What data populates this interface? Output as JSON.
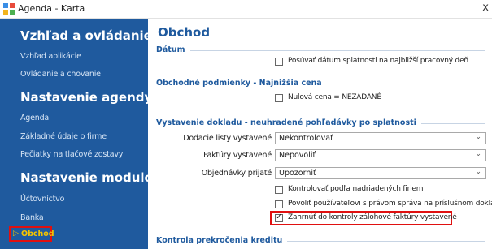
{
  "window": {
    "title": "Agenda - Karta",
    "close_glyph": "x"
  },
  "sidebar": {
    "sections": [
      {
        "heading": "Vzhľad a ovládanie",
        "items": [
          "Vzhľad aplikácie",
          "Ovládanie a chovanie"
        ]
      },
      {
        "heading": "Nastavenie agendy",
        "items": [
          "Agenda",
          "Základné údaje o firme",
          "Pečiatky na tlačové zostavy"
        ]
      },
      {
        "heading": "Nastavenie modulov",
        "items": [
          "Účtovníctvo",
          "Banka"
        ]
      }
    ],
    "active_item": "Obchod",
    "active_marker_icon": "triangle-right-icon"
  },
  "main": {
    "title": "Obchod",
    "sections": {
      "datum": {
        "title": "Dátum",
        "opt_posuvat": {
          "label": "Posúvať dátum splatnosti na najbližší pracovný deň",
          "checked": false
        }
      },
      "podmienky": {
        "title": "Obchodné podmienky - Najnižšia cena",
        "opt_nulova": {
          "label": "Nulová cena = NEZADANÉ",
          "checked": false
        }
      },
      "vystavenie": {
        "title": "Vystavenie dokladu - neuhradené pohľadávky po splatnosti",
        "fields": {
          "dodacie": {
            "label": "Dodacie listy vystavené",
            "value": "Nekontrolovať"
          },
          "faktury": {
            "label": "Faktúry vystavené",
            "value": "Nepovoliť"
          },
          "objednavky": {
            "label": "Objednávky prijaté",
            "value": "Upozorniť"
          }
        },
        "opt_kontrolovat": {
          "label": "Kontrolovať podľa nadriadených firiem",
          "checked": false
        },
        "opt_povolit": {
          "label": "Povoliť používateľovi s právom správa na príslušnom doklade.",
          "checked": false
        },
        "opt_zahrnut": {
          "label": "Zahrnúť do kontroly zálohové faktúry vystavené",
          "checked": true
        }
      },
      "kontrola": {
        "title": "Kontrola prekročenia kreditu"
      }
    }
  },
  "colors": {
    "sidebar_bg": "#1f5a9e",
    "accent": "#1f5a9e",
    "active_text": "#f4c400",
    "highlight": "#e01010"
  }
}
